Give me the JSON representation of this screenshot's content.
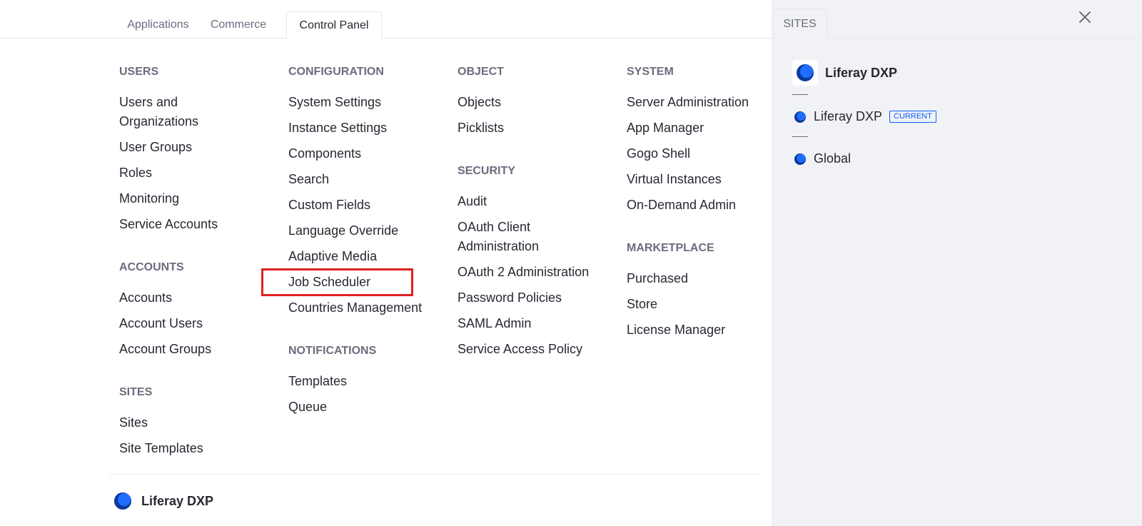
{
  "tabs": {
    "applications": "Applications",
    "commerce": "Commerce",
    "control_panel": "Control Panel"
  },
  "sites_tab": "SITES",
  "columns": {
    "users": {
      "title": "USERS",
      "items": [
        "Users and Organizations",
        "User Groups",
        "Roles",
        "Monitoring",
        "Service Accounts"
      ]
    },
    "accounts": {
      "title": "ACCOUNTS",
      "items": [
        "Accounts",
        "Account Users",
        "Account Groups"
      ]
    },
    "sites": {
      "title": "SITES",
      "items": [
        "Sites",
        "Site Templates"
      ]
    },
    "configuration": {
      "title": "CONFIGURATION",
      "items": [
        "System Settings",
        "Instance Settings",
        "Components",
        "Search",
        "Custom Fields",
        "Language Override",
        "Adaptive Media",
        "Job Scheduler",
        "Countries Management"
      ]
    },
    "notifications": {
      "title": "NOTIFICATIONS",
      "items": [
        "Templates",
        "Queue"
      ]
    },
    "object": {
      "title": "OBJECT",
      "items": [
        "Objects",
        "Picklists"
      ]
    },
    "security": {
      "title": "SECURITY",
      "items": [
        "Audit",
        "OAuth Client Administration",
        "OAuth 2 Administration",
        "Password Policies",
        "SAML Admin",
        "Service Access Policy"
      ]
    },
    "system": {
      "title": "SYSTEM",
      "items": [
        "Server Administration",
        "App Manager",
        "Gogo Shell",
        "Virtual Instances",
        "On-Demand Admin"
      ]
    },
    "marketplace": {
      "title": "MARKETPLACE",
      "items": [
        "Purchased",
        "Store",
        "License Manager"
      ]
    }
  },
  "footer": {
    "site_name": "Liferay DXP"
  },
  "right_panel": {
    "site_name": "Liferay DXP",
    "items": [
      {
        "name": "Liferay DXP",
        "badge": "CURRENT"
      },
      {
        "name": "Global"
      }
    ]
  },
  "icons": {
    "logo": "liferay-logo-icon",
    "close": "close-icon"
  },
  "colors": {
    "accent": "#0b5fff",
    "logo_dark": "#0b3a9e",
    "logo_light": "#1f6fff",
    "highlight": "#e02020"
  }
}
